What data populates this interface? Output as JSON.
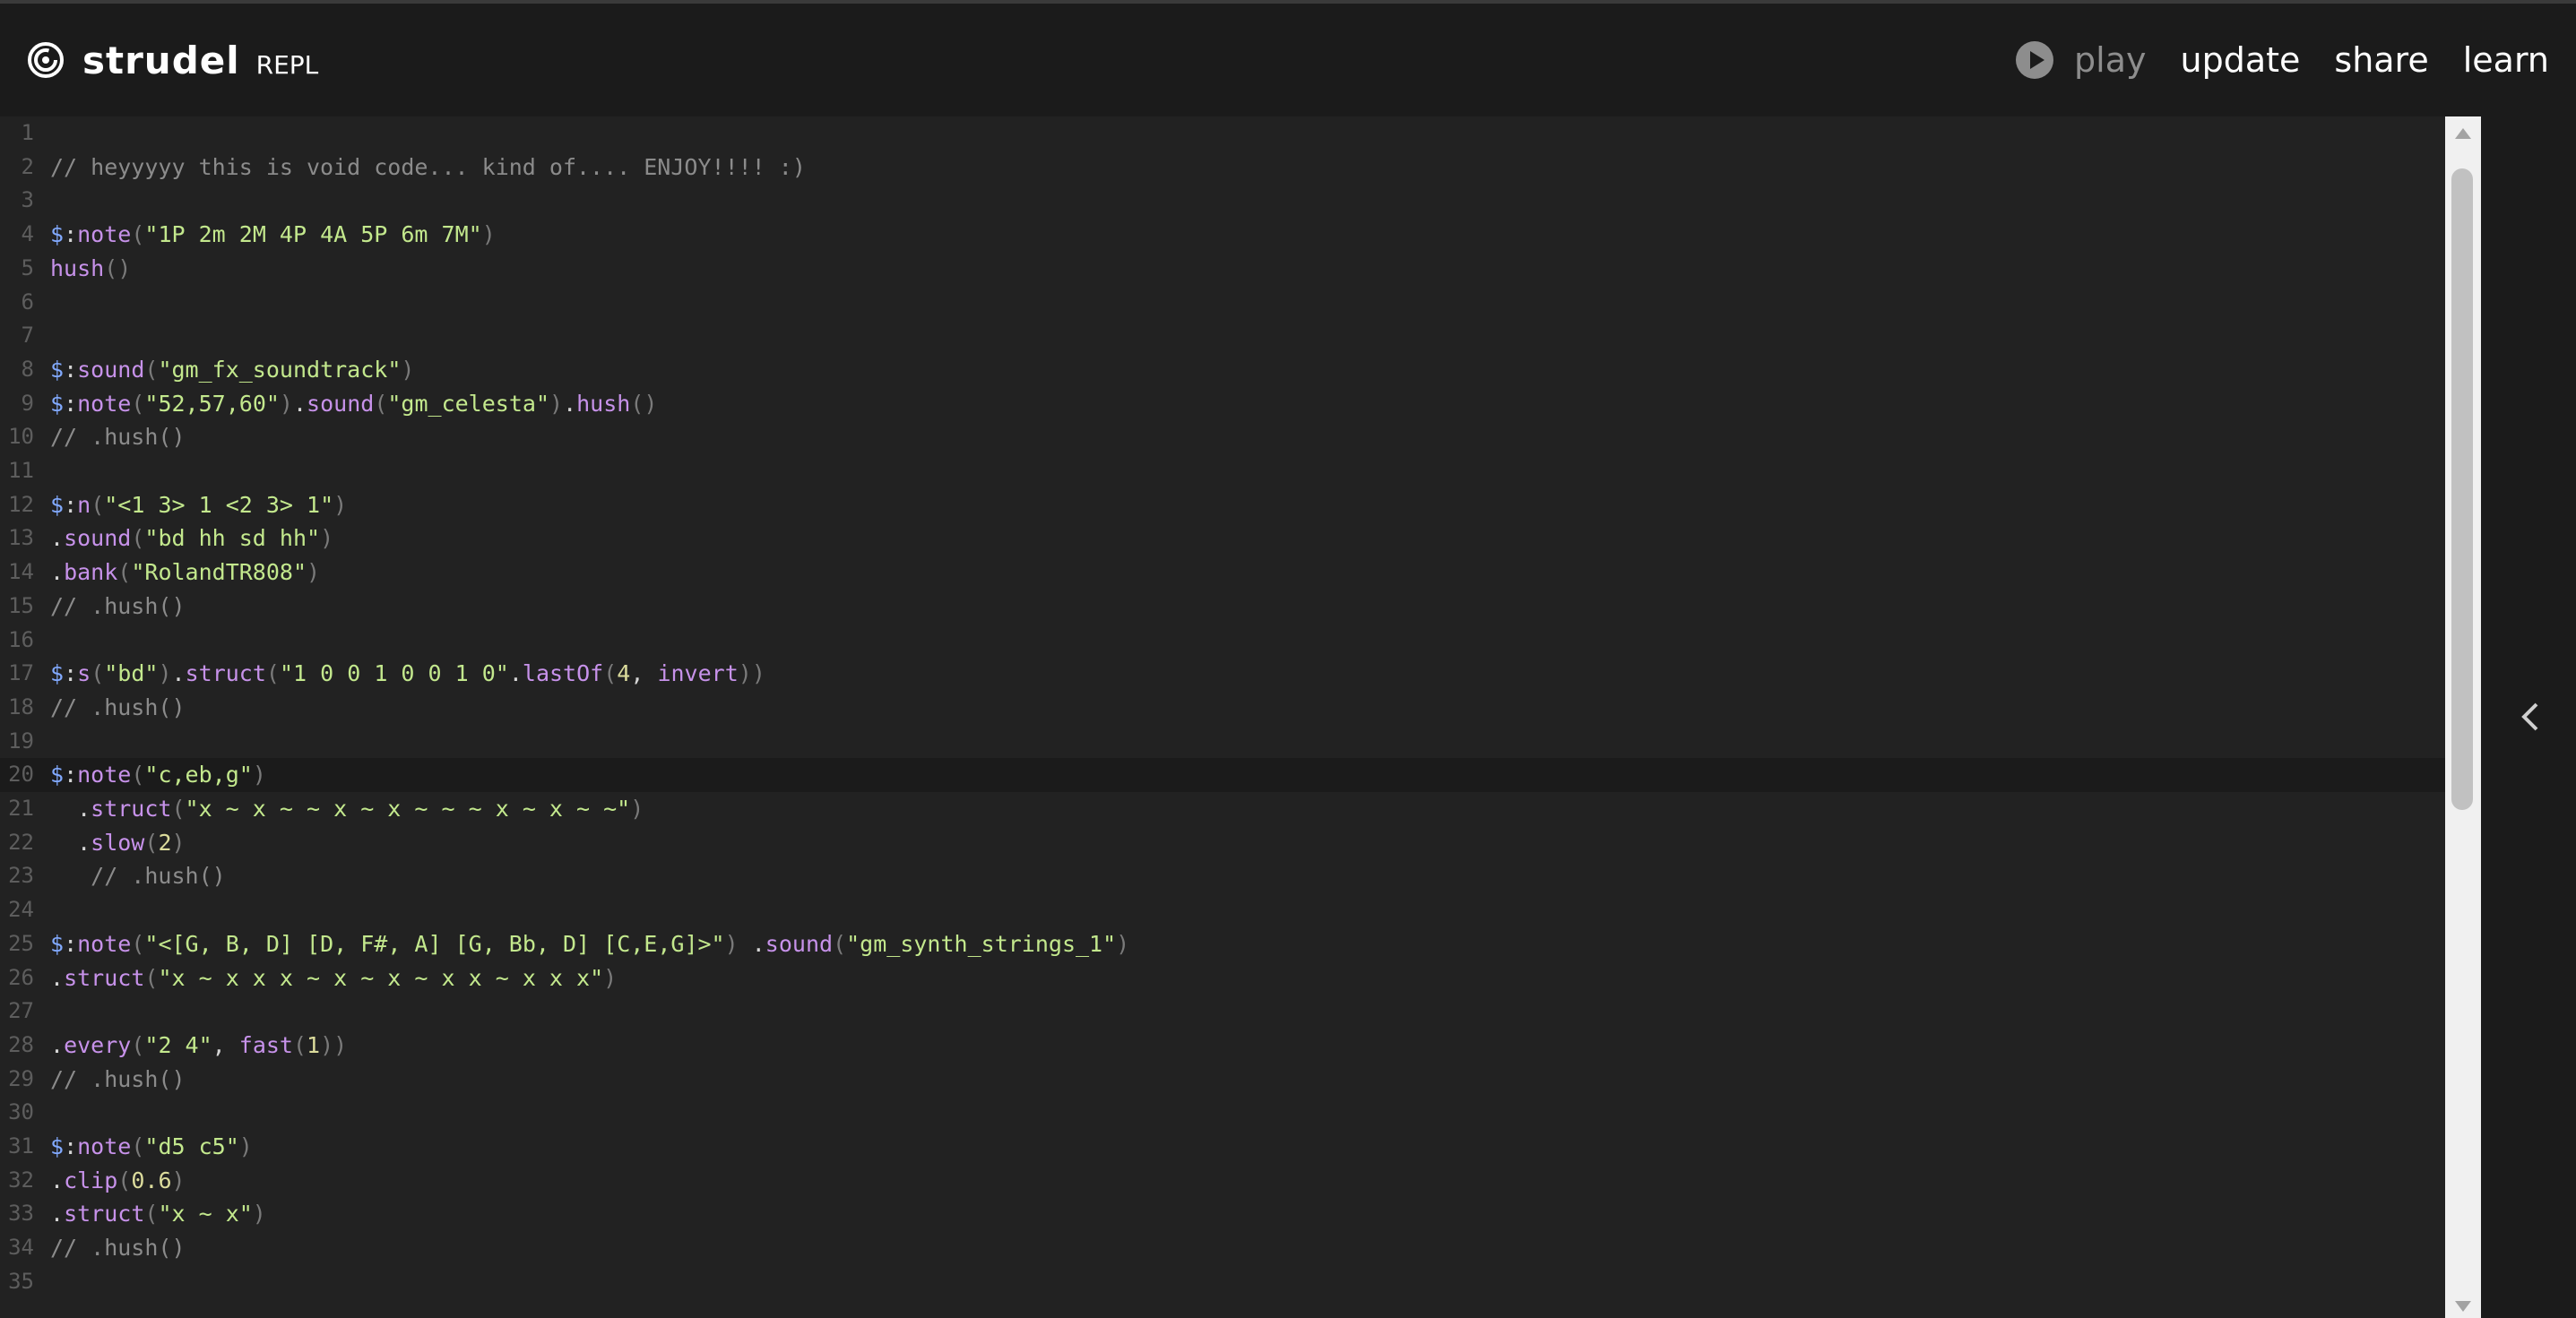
{
  "header": {
    "brand_name": "strudel",
    "brand_sub": "REPL",
    "nav": {
      "play_label": "play",
      "update_label": "update",
      "share_label": "share",
      "learn_label": "learn"
    }
  },
  "editor": {
    "active_line": 20,
    "lines": [
      {
        "n": "1",
        "tokens": []
      },
      {
        "n": "2",
        "tokens": [
          [
            "cm",
            "// heyyyyy this is void code... kind of.... ENJOY!!!! :)"
          ]
        ]
      },
      {
        "n": "3",
        "tokens": []
      },
      {
        "n": "4",
        "tokens": [
          [
            "var",
            "$"
          ],
          [
            "plain",
            ":"
          ],
          [
            "fn",
            "note"
          ],
          [
            "pun",
            "("
          ],
          [
            "str",
            "\"1P 2m 2M 4P 4A 5P 6m 7M\""
          ],
          [
            "pun",
            ")"
          ]
        ]
      },
      {
        "n": "5",
        "tokens": [
          [
            "fn",
            "hush"
          ],
          [
            "pun",
            "()"
          ]
        ]
      },
      {
        "n": "6",
        "tokens": []
      },
      {
        "n": "7",
        "tokens": []
      },
      {
        "n": "8",
        "tokens": [
          [
            "var",
            "$"
          ],
          [
            "plain",
            ":"
          ],
          [
            "fn",
            "sound"
          ],
          [
            "pun",
            "("
          ],
          [
            "str",
            "\"gm_fx_soundtrack\""
          ],
          [
            "pun",
            ")"
          ]
        ]
      },
      {
        "n": "9",
        "tokens": [
          [
            "var",
            "$"
          ],
          [
            "plain",
            ":"
          ],
          [
            "fn",
            "note"
          ],
          [
            "pun",
            "("
          ],
          [
            "str",
            "\"52,57,60\""
          ],
          [
            "pun",
            ")"
          ],
          [
            "plain",
            "."
          ],
          [
            "fn",
            "sound"
          ],
          [
            "pun",
            "("
          ],
          [
            "str",
            "\"gm_celesta\""
          ],
          [
            "pun",
            ")"
          ],
          [
            "plain",
            "."
          ],
          [
            "fn",
            "hush"
          ],
          [
            "pun",
            "()"
          ]
        ]
      },
      {
        "n": "10",
        "tokens": [
          [
            "cm",
            "// .hush()"
          ]
        ]
      },
      {
        "n": "11",
        "tokens": []
      },
      {
        "n": "12",
        "tokens": [
          [
            "var",
            "$"
          ],
          [
            "plain",
            ":"
          ],
          [
            "fn",
            "n"
          ],
          [
            "pun",
            "("
          ],
          [
            "str",
            "\"<1 3> 1 <2 3> 1\""
          ],
          [
            "pun",
            ")"
          ]
        ]
      },
      {
        "n": "13",
        "tokens": [
          [
            "plain",
            "."
          ],
          [
            "fn",
            "sound"
          ],
          [
            "pun",
            "("
          ],
          [
            "str",
            "\"bd hh sd hh\""
          ],
          [
            "pun",
            ")"
          ]
        ]
      },
      {
        "n": "14",
        "tokens": [
          [
            "plain",
            "."
          ],
          [
            "fn",
            "bank"
          ],
          [
            "pun",
            "("
          ],
          [
            "str",
            "\"RolandTR808\""
          ],
          [
            "pun",
            ")"
          ]
        ]
      },
      {
        "n": "15",
        "tokens": [
          [
            "cm",
            "// .hush()"
          ]
        ]
      },
      {
        "n": "16",
        "tokens": []
      },
      {
        "n": "17",
        "tokens": [
          [
            "var",
            "$"
          ],
          [
            "plain",
            ":"
          ],
          [
            "fn",
            "s"
          ],
          [
            "pun",
            "("
          ],
          [
            "str",
            "\"bd\""
          ],
          [
            "pun",
            ")"
          ],
          [
            "plain",
            "."
          ],
          [
            "fn",
            "struct"
          ],
          [
            "pun",
            "("
          ],
          [
            "str",
            "\"1 0 0 1 0 0 1 0\""
          ],
          [
            "plain",
            "."
          ],
          [
            "fn",
            "lastOf"
          ],
          [
            "pun",
            "("
          ],
          [
            "num",
            "4"
          ],
          [
            "plain",
            ", "
          ],
          [
            "fn",
            "invert"
          ],
          [
            "pun",
            "))"
          ]
        ]
      },
      {
        "n": "18",
        "tokens": [
          [
            "cm",
            "// .hush()"
          ]
        ]
      },
      {
        "n": "19",
        "tokens": []
      },
      {
        "n": "20",
        "tokens": [
          [
            "var",
            "$"
          ],
          [
            "plain",
            ":"
          ],
          [
            "fn",
            "note"
          ],
          [
            "pun",
            "("
          ],
          [
            "str",
            "\"c,eb,g\""
          ],
          [
            "pun",
            ")"
          ]
        ]
      },
      {
        "n": "21",
        "tokens": [
          [
            "plain",
            "  ."
          ],
          [
            "fn",
            "struct"
          ],
          [
            "pun",
            "("
          ],
          [
            "str",
            "\"x ~ x ~ ~ x ~ x ~ ~ ~ x ~ x ~ ~\""
          ],
          [
            "pun",
            ")"
          ]
        ]
      },
      {
        "n": "22",
        "tokens": [
          [
            "plain",
            "  ."
          ],
          [
            "fn",
            "slow"
          ],
          [
            "pun",
            "("
          ],
          [
            "num",
            "2"
          ],
          [
            "pun",
            ")"
          ]
        ]
      },
      {
        "n": "23",
        "tokens": [
          [
            "cm",
            "   // .hush()"
          ]
        ]
      },
      {
        "n": "24",
        "tokens": []
      },
      {
        "n": "25",
        "tokens": [
          [
            "var",
            "$"
          ],
          [
            "plain",
            ":"
          ],
          [
            "fn",
            "note"
          ],
          [
            "pun",
            "("
          ],
          [
            "str",
            "\"<[G, B, D] [D, F#, A] [G, Bb, D] [C,E,G]>\""
          ],
          [
            "pun",
            ")"
          ],
          [
            "plain",
            " ."
          ],
          [
            "fn",
            "sound"
          ],
          [
            "pun",
            "("
          ],
          [
            "str",
            "\"gm_synth_strings_1\""
          ],
          [
            "pun",
            ")"
          ]
        ]
      },
      {
        "n": "26",
        "tokens": [
          [
            "plain",
            "."
          ],
          [
            "fn",
            "struct"
          ],
          [
            "pun",
            "("
          ],
          [
            "str",
            "\"x ~ x x x ~ x ~ x ~ x x ~ x x x\""
          ],
          [
            "pun",
            ")"
          ]
        ]
      },
      {
        "n": "27",
        "tokens": []
      },
      {
        "n": "28",
        "tokens": [
          [
            "plain",
            "."
          ],
          [
            "fn",
            "every"
          ],
          [
            "pun",
            "("
          ],
          [
            "str",
            "\"2 4\""
          ],
          [
            "plain",
            ", "
          ],
          [
            "fn",
            "fast"
          ],
          [
            "pun",
            "("
          ],
          [
            "num",
            "1"
          ],
          [
            "pun",
            "))"
          ]
        ]
      },
      {
        "n": "29",
        "tokens": [
          [
            "cm",
            "// .hush()"
          ]
        ]
      },
      {
        "n": "30",
        "tokens": []
      },
      {
        "n": "31",
        "tokens": [
          [
            "var",
            "$"
          ],
          [
            "plain",
            ":"
          ],
          [
            "fn",
            "note"
          ],
          [
            "pun",
            "("
          ],
          [
            "str",
            "\"d5 c5\""
          ],
          [
            "pun",
            ")"
          ]
        ]
      },
      {
        "n": "32",
        "tokens": [
          [
            "plain",
            "."
          ],
          [
            "fn",
            "clip"
          ],
          [
            "pun",
            "("
          ],
          [
            "num",
            "0.6"
          ],
          [
            "pun",
            ")"
          ]
        ]
      },
      {
        "n": "33",
        "tokens": [
          [
            "plain",
            "."
          ],
          [
            "fn",
            "struct"
          ],
          [
            "pun",
            "("
          ],
          [
            "str",
            "\"x ~ x\""
          ],
          [
            "pun",
            ")"
          ]
        ]
      },
      {
        "n": "34",
        "tokens": [
          [
            "cm",
            "// .hush()"
          ]
        ]
      },
      {
        "n": "35",
        "tokens": []
      }
    ]
  },
  "icons": {
    "logo": "strudel-spiral-icon",
    "play": "play-circle-icon",
    "scroll_up": "arrow-up-icon",
    "scroll_down": "arrow-down-icon",
    "panel_toggle": "chevron-left-icon"
  },
  "colors": {
    "background": "#222222",
    "header": "#1b1b1b",
    "string": "#c3e88d",
    "function": "#c792ea",
    "comment": "#8b8b8b",
    "variable": "#82aaff"
  }
}
